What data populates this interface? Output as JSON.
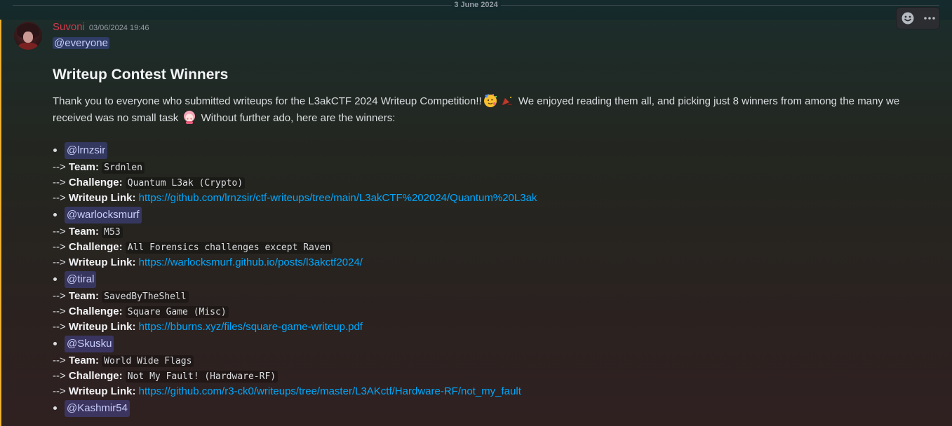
{
  "date_divider": "3 June 2024",
  "message": {
    "author": "Suvoni",
    "timestamp": "03/06/2024 19:46",
    "everyone_mention": "@everyone",
    "heading": "Writeup Contest Winners",
    "intro_part1": "Thank you to everyone who submitted writeups for the L3akCTF 2024 Writeup Competition!!",
    "intro_part2": " We enjoyed reading them all, and picking just 8 winners from among the many we received was no small task ",
    "intro_part3": " Without further ado, here are the winners:",
    "arrow": "-->",
    "team_key": "Team:",
    "challenge_key": "Challenge:",
    "writeup_key": "Writeup Link:"
  },
  "winners": [
    {
      "mention": "@lrnzsir",
      "team": "Srdnlen",
      "challenge": "Quantum L3ak (Crypto)",
      "link": "https://github.com/lrnzsir/ctf-writeups/tree/main/L3akCTF%202024/Quantum%20L3ak"
    },
    {
      "mention": "@warlocksmurf",
      "team": "M53",
      "challenge": "All Forensics challenges except Raven",
      "link": "https://warlocksmurf.github.io/posts/l3akctf2024/"
    },
    {
      "mention": "@tiral",
      "team": "SavedByTheShell",
      "challenge": "Square Game (Misc)",
      "link": "https://bburns.xyz/files/square-game-writeup.pdf"
    },
    {
      "mention": "@Skusku",
      "team": "World Wide Flags",
      "challenge": "Not My Fault! (Hardware-RF)",
      "link": "https://github.com/r3-ck0/writeups/tree/master/L3AKctf/Hardware-RF/not_my_fault"
    },
    {
      "mention": "@Kashmir54"
    }
  ],
  "icons": {
    "toolbar": [
      "add-reaction-icon",
      "more-options-icon"
    ],
    "emojis": [
      "partying-face-emoji",
      "party-horn-emoji",
      "blushing-character-emoji"
    ]
  },
  "colors": {
    "username": "#d13a4c",
    "link": "#00a8fc",
    "mention_bg": "rgba(88,101,242,0.3)",
    "highlight_bar": "#f0b232"
  }
}
